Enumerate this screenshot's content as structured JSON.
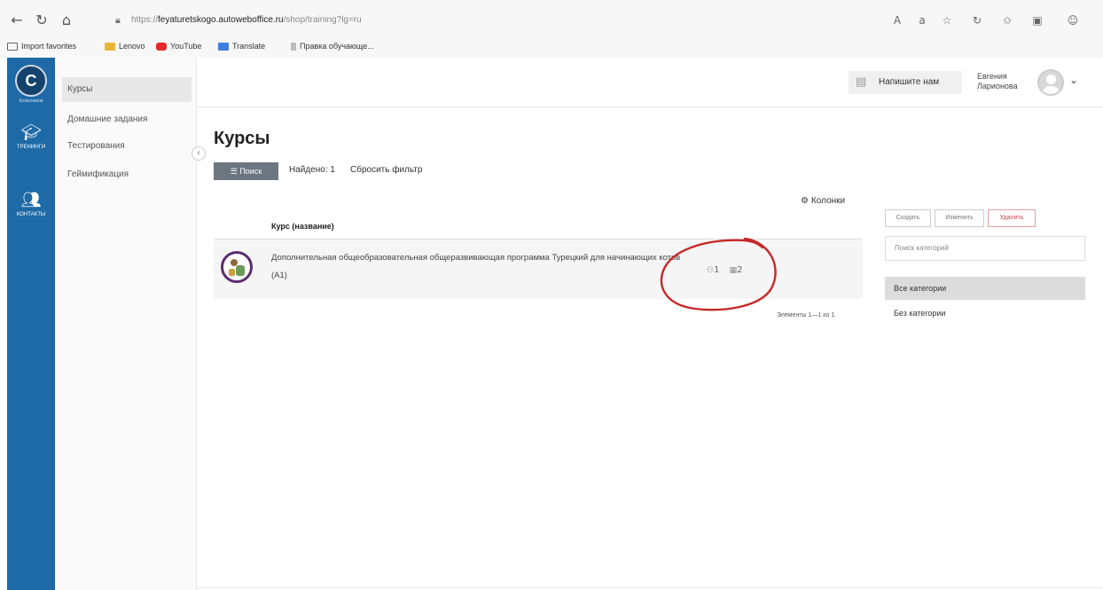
{
  "browser": {
    "url_prefix": "https://",
    "url_domain": "feyaturetskogo.autoweboffice.ru",
    "url_path": "/shop/training?lg=ru",
    "bookmarks": [
      {
        "label": "Import favorites"
      },
      {
        "label": "Lenovo"
      },
      {
        "label": "YouTube"
      },
      {
        "label": "Translate"
      },
      {
        "label": "Правка обучающе..."
      }
    ]
  },
  "sidebar": {
    "logo_text": "C",
    "logo_caption": "Колесников",
    "items": [
      {
        "label": "ТРЕНИНГИ",
        "icon": "graduation-cap-icon"
      },
      {
        "label": "КОНТАКТЫ",
        "icon": "users-icon"
      }
    ]
  },
  "subnav": {
    "items": [
      {
        "label": "Курсы"
      },
      {
        "label": "Домашние задания"
      },
      {
        "label": "Тестирования"
      },
      {
        "label": "Геймификация"
      }
    ]
  },
  "header": {
    "write_us": "Напишите нам",
    "user_first": "Евгения",
    "user_last": "Ларионова"
  },
  "main": {
    "title": "Курсы",
    "search_label": "Поиск",
    "found": "Найдено: 1",
    "reset_filter": "Сбросить фильтр",
    "columns_label": "Колонки",
    "table_header": "Курс (название)",
    "courses": [
      {
        "title": "Дополнительная общеобразовательная общеразвивающая программа Турецкий для начинающих котов (А1)",
        "stat_students": "1",
        "stat_lessons": "2"
      }
    ],
    "pager": "Элементы 1—1 из 1."
  },
  "categories": {
    "create": "Создать",
    "edit": "Изменить",
    "delete": "Удалить",
    "search_placeholder": "Поиск категорий",
    "items": [
      {
        "label": "Все категории"
      },
      {
        "label": "Без категории"
      }
    ]
  },
  "colors": {
    "sidebar": "#1e6aa6",
    "search_button": "#6b7680",
    "annotation": "#c62828"
  }
}
